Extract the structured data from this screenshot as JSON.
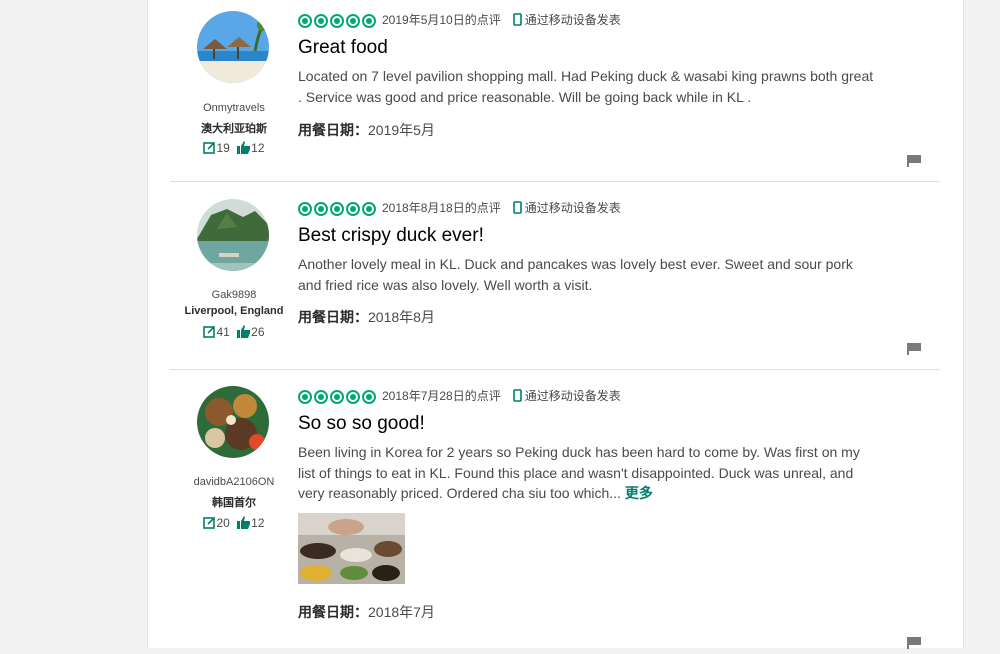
{
  "reviews": [
    {
      "username": "Onmytravels",
      "location": "澳大利亚珀斯",
      "review_count": "19",
      "helpful_count": "12",
      "rating": 5,
      "review_date": "2019年5月10日的点评",
      "mobile_label": "通过移动设备发表",
      "title": "Great food",
      "body": "Located on 7 level pavilion shopping mall. Had Peking duck & wasabi king prawns both great . Service was good and price reasonable. Will be going back while in KL .",
      "visit_label": "用餐日期：",
      "visit_date": "2019年5月"
    },
    {
      "username": "Gak9898",
      "location": "Liverpool, England",
      "review_count": "41",
      "helpful_count": "26",
      "rating": 5,
      "review_date": "2018年8月18日的点评",
      "mobile_label": "通过移动设备发表",
      "title": "Best crispy duck ever!",
      "body": "Another lovely meal in KL. Duck and pancakes was lovely best ever. Sweet and sour pork and fried rice was also lovely. Well worth a visit.",
      "visit_label": "用餐日期：",
      "visit_date": "2018年8月"
    },
    {
      "username": "davidbA2106ON",
      "location": "韩国首尔",
      "review_count": "20",
      "helpful_count": "12",
      "rating": 5,
      "review_date": "2018年7月28日的点评",
      "mobile_label": "通过移动设备发表",
      "title": "So so so good!",
      "body": "Been living in Korea for 2 years so Peking duck has been hard to come by. Was first on my list of things to eat in KL. Found this place and wasn't disappointed. Duck was unreal, and very reasonably priced. Ordered cha siu too which...",
      "more_label": "更多",
      "visit_label": "用餐日期：",
      "visit_date": "2018年7月"
    }
  ],
  "colors": {
    "accent": "#00aa6c",
    "link": "#00806a"
  },
  "icons": {
    "rating": "rating-bubble-icon",
    "mobile": "mobile-phone-icon",
    "review": "review-count-icon",
    "helpful": "thumbs-up-icon",
    "flag": "flag-icon"
  }
}
